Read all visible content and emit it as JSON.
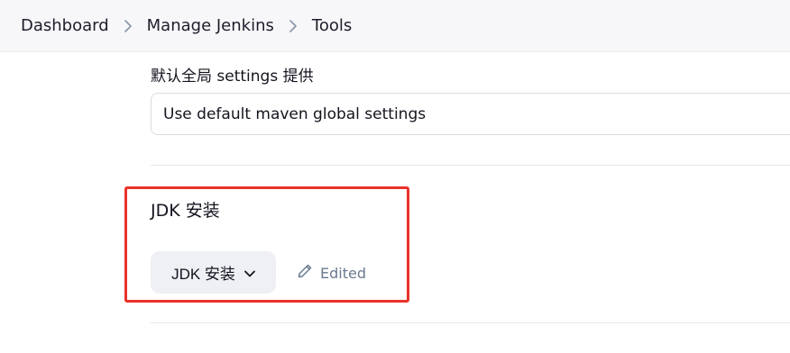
{
  "breadcrumb": {
    "items": [
      "Dashboard",
      "Manage Jenkins",
      "Tools"
    ]
  },
  "maven_global_settings": {
    "label": "默认全局 settings 提供",
    "selected_value": "Use default maven global settings"
  },
  "jdk": {
    "title": "JDK 安装",
    "button_label": "JDK 安装",
    "status_text": "Edited"
  },
  "icons": {
    "breadcrumb_separator": "chevron-right-icon",
    "dropdown": "chevron-down-icon",
    "edited": "pencil-icon"
  },
  "colors": {
    "highlight": "#e8322b",
    "edited_text": "#6b7a90",
    "button_bg": "#eef0f4"
  }
}
